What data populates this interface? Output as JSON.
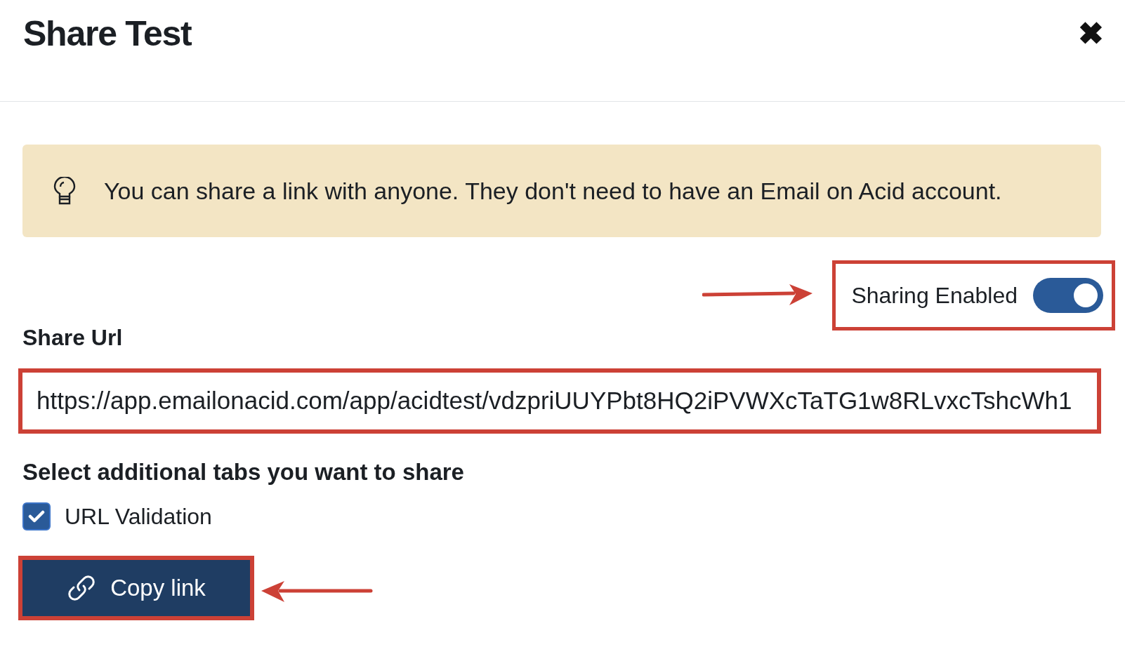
{
  "dialog": {
    "title": "Share Test",
    "close": "✖"
  },
  "notice": {
    "text": "You can share a link with anyone. They don't need to have an Email on Acid account."
  },
  "sharing_toggle": {
    "label": "Sharing Enabled",
    "on": true
  },
  "share_url": {
    "label": "Share Url",
    "value": "https://app.emailonacid.com/app/acidtest/vdzpriUUYPbt8HQ2iPVWXcTaTG1w8RLvxcTshcWh1"
  },
  "tabs_section": {
    "label": "Select additional tabs you want to share",
    "options": [
      {
        "label": "URL Validation",
        "checked": true
      }
    ]
  },
  "copy_button": {
    "label": "Copy link"
  }
}
